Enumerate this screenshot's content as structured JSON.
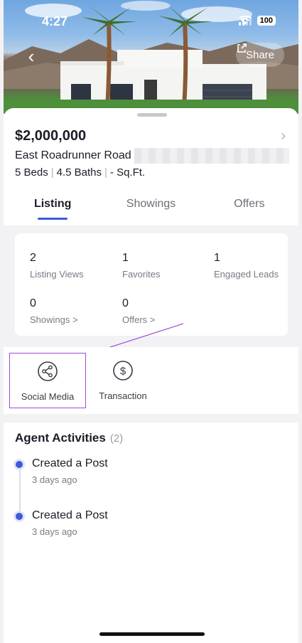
{
  "status_bar": {
    "time": "4:27",
    "battery": "100"
  },
  "hero": {
    "share_label": "Share"
  },
  "listing": {
    "price": "$2,000,000",
    "address": "East Roadrunner Road",
    "beds": "5 Beds",
    "baths": "4.5 Baths",
    "sqft": "- Sq.Ft."
  },
  "tabs": [
    {
      "label": "Listing",
      "active": true
    },
    {
      "label": "Showings",
      "active": false
    },
    {
      "label": "Offers",
      "active": false
    }
  ],
  "stats": [
    {
      "value": "2",
      "label": "Listing Views"
    },
    {
      "value": "1",
      "label": "Favorites"
    },
    {
      "value": "1",
      "label": "Engaged Leads"
    },
    {
      "value": "0",
      "label": "Showings >"
    },
    {
      "value": "0",
      "label": "Offers >"
    }
  ],
  "tools": [
    {
      "label": "Social Media",
      "icon": "share-network-icon"
    },
    {
      "label": "Transaction",
      "icon": "dollar-circle-icon"
    }
  ],
  "activities": {
    "title": "Agent Activities",
    "count": "(2)",
    "items": [
      {
        "title": "Created a Post",
        "time": "3 days ago"
      },
      {
        "title": "Created a Post",
        "time": "3 days ago"
      }
    ]
  },
  "colors": {
    "accent": "#3d5ad8",
    "highlight": "#a14ad6"
  }
}
